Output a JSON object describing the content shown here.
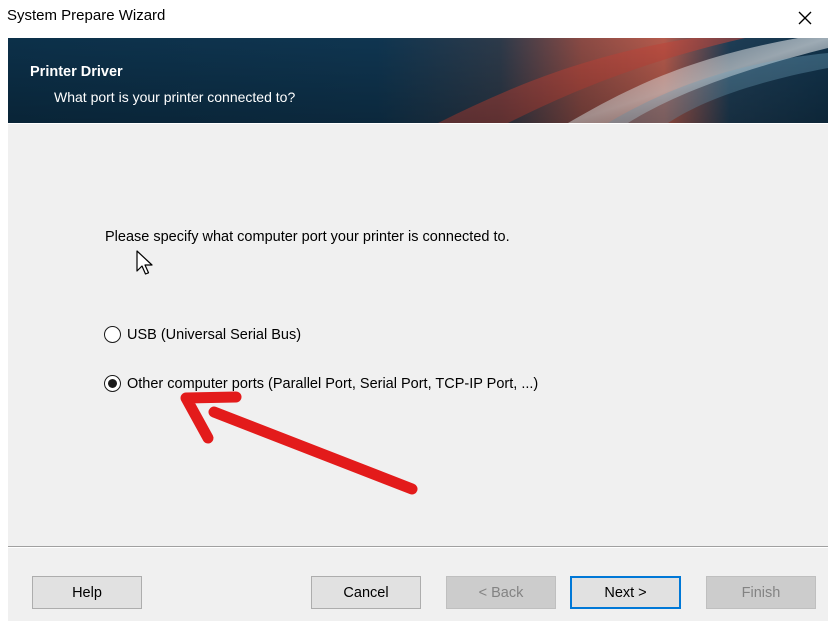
{
  "window": {
    "title": "System Prepare Wizard",
    "close_icon": "close-icon"
  },
  "banner": {
    "title": "Printer Driver",
    "subtitle": "What port is your printer connected to?",
    "colors": {
      "base": "#0f2f48",
      "accent": "#c0392b"
    }
  },
  "content": {
    "instruction": "Please specify what computer port your printer is connected to.",
    "options": [
      {
        "label": "USB (Universal Serial Bus)",
        "selected": false
      },
      {
        "label": "Other computer ports (Parallel Port, Serial Port, TCP-IP Port, ...)",
        "selected": true
      }
    ],
    "annotation": {
      "icon": "red-arrow-icon",
      "color": "#e31b1b"
    }
  },
  "buttons": {
    "help": {
      "label": "Help",
      "enabled": true
    },
    "cancel": {
      "label": "Cancel",
      "enabled": true
    },
    "back": {
      "label": "< Back",
      "enabled": false
    },
    "next": {
      "label": "Next >",
      "enabled": true,
      "default": true
    },
    "finish": {
      "label": "Finish",
      "enabled": false
    }
  }
}
